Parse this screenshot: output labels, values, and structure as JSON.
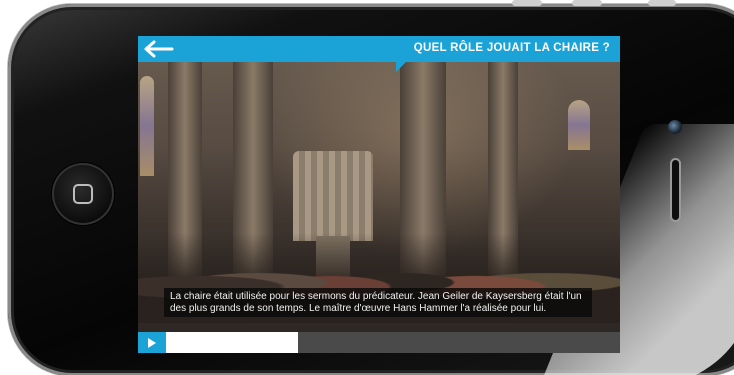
{
  "header": {
    "title": "QUEL RÔLE JOUAIT LA CHAIRE ?"
  },
  "video": {
    "caption": "La chaire était utilisée pour les sermons du prédicateur. Jean Geiler de Kaysersberg était l'un des plus grands de son temps. Le maître d'œuvre Hans Hammer l'a réalisée pour lui.",
    "progress_fraction": 0.29
  },
  "icons": {
    "back": "arrow-left-icon",
    "play": "play-icon",
    "home": "home-button-icon"
  },
  "colors": {
    "accent": "#1ba3d8",
    "caption_bg": "#0a0a0a",
    "progress_fill": "#ffffff",
    "progress_track": "#4a4a4a"
  }
}
